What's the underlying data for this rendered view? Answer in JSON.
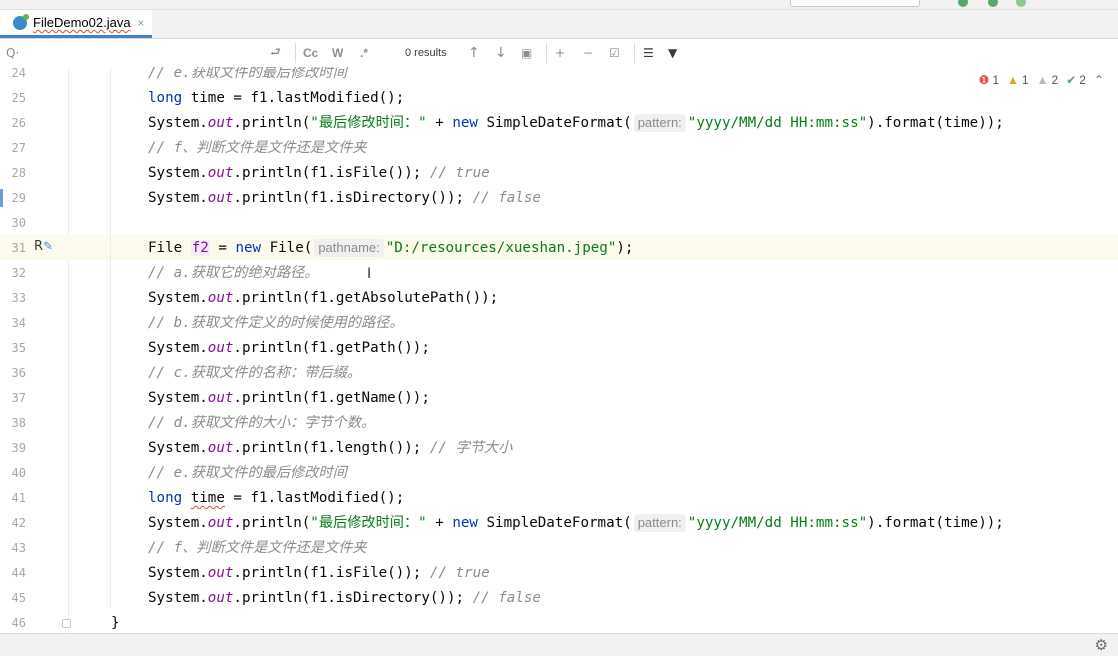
{
  "tab": {
    "filename": "FileDemo02.java",
    "close": "×"
  },
  "search": {
    "icon": "Q·",
    "match_case": "Cc",
    "words": "W",
    "regex": ".*",
    "results": "0 results"
  },
  "inspections": {
    "errors": "1",
    "warnings": "1",
    "weak_warnings": "2",
    "ok": "2"
  },
  "status": {
    "gear": "⚙"
  },
  "lines": [
    {
      "n": "24",
      "tokens": [
        {
          "t": "cmt",
          "v": "// e.获取文件的最后修改时间"
        }
      ]
    },
    {
      "n": "25",
      "tokens": [
        {
          "t": "kw",
          "v": "long"
        },
        {
          "t": "plain",
          "v": " time = f1.lastModified();"
        }
      ]
    },
    {
      "n": "26",
      "tokens": [
        {
          "t": "plain",
          "v": "System."
        },
        {
          "t": "field",
          "v": "out"
        },
        {
          "t": "plain",
          "v": ".println("
        },
        {
          "t": "str",
          "v": "\"最后修改时间：\""
        },
        {
          "t": "plain",
          "v": " + "
        },
        {
          "t": "kw",
          "v": "new"
        },
        {
          "t": "plain",
          "v": " SimpleDateFormat("
        },
        {
          "t": "hint",
          "v": "pattern:"
        },
        {
          "t": "str",
          "v": "\"yyyy/MM/dd HH:mm:ss\""
        },
        {
          "t": "plain",
          "v": ").format(time));"
        }
      ]
    },
    {
      "n": "27",
      "tokens": [
        {
          "t": "cmt",
          "v": "// f、判断文件是文件还是文件夹"
        }
      ]
    },
    {
      "n": "28",
      "tokens": [
        {
          "t": "plain",
          "v": "System."
        },
        {
          "t": "field",
          "v": "out"
        },
        {
          "t": "plain",
          "v": ".println(f1.isFile()); "
        },
        {
          "t": "cmt",
          "v": "// true"
        }
      ]
    },
    {
      "n": "29",
      "tokens": [
        {
          "t": "plain",
          "v": "System."
        },
        {
          "t": "field",
          "v": "out"
        },
        {
          "t": "plain",
          "v": ".println(f1.isDirectory()); "
        },
        {
          "t": "cmt",
          "v": "// false"
        }
      ]
    },
    {
      "n": "30",
      "tokens": []
    },
    {
      "n": "31",
      "tokens": [
        {
          "t": "plain",
          "v": "File "
        },
        {
          "t": "local",
          "v": "f2"
        },
        {
          "t": "plain",
          "v": " = "
        },
        {
          "t": "kw",
          "v": "new"
        },
        {
          "t": "plain",
          "v": " File("
        },
        {
          "t": "hint",
          "v": "pathname:"
        },
        {
          "t": "str",
          "v": "\"D:/resources/xueshan.jpeg\""
        },
        {
          "t": "plain",
          "v": ");"
        }
      ]
    },
    {
      "n": "32",
      "tokens": [
        {
          "t": "cmt",
          "v": "// a.获取它的绝对路径。"
        }
      ]
    },
    {
      "n": "33",
      "tokens": [
        {
          "t": "plain",
          "v": "System."
        },
        {
          "t": "field",
          "v": "out"
        },
        {
          "t": "plain",
          "v": ".println(f1.getAbsolutePath());"
        }
      ]
    },
    {
      "n": "34",
      "tokens": [
        {
          "t": "cmt",
          "v": "// b.获取文件定义的时候使用的路径。"
        }
      ]
    },
    {
      "n": "35",
      "tokens": [
        {
          "t": "plain",
          "v": "System."
        },
        {
          "t": "field",
          "v": "out"
        },
        {
          "t": "plain",
          "v": ".println(f1.getPath());"
        }
      ]
    },
    {
      "n": "36",
      "tokens": [
        {
          "t": "cmt",
          "v": "// c.获取文件的名称：带后缀。"
        }
      ]
    },
    {
      "n": "37",
      "tokens": [
        {
          "t": "plain",
          "v": "System."
        },
        {
          "t": "field",
          "v": "out"
        },
        {
          "t": "plain",
          "v": ".println(f1.getName());"
        }
      ]
    },
    {
      "n": "38",
      "tokens": [
        {
          "t": "cmt",
          "v": "// d.获取文件的大小：字节个数。"
        }
      ]
    },
    {
      "n": "39",
      "tokens": [
        {
          "t": "plain",
          "v": "System."
        },
        {
          "t": "field",
          "v": "out"
        },
        {
          "t": "plain",
          "v": ".println(f1.length()); "
        },
        {
          "t": "cmt",
          "v": "// 字节大小"
        }
      ]
    },
    {
      "n": "40",
      "tokens": [
        {
          "t": "cmt",
          "v": "// e.获取文件的最后修改时间"
        }
      ]
    },
    {
      "n": "41",
      "tokens": [
        {
          "t": "kw",
          "v": "long"
        },
        {
          "t": "plain",
          "v": " "
        },
        {
          "t": "squig",
          "v": "time"
        },
        {
          "t": "plain",
          "v": " = f1.lastModified();"
        }
      ]
    },
    {
      "n": "42",
      "tokens": [
        {
          "t": "plain",
          "v": "System."
        },
        {
          "t": "field",
          "v": "out"
        },
        {
          "t": "plain",
          "v": ".println("
        },
        {
          "t": "str",
          "v": "\"最后修改时间：\""
        },
        {
          "t": "plain",
          "v": " + "
        },
        {
          "t": "kw",
          "v": "new"
        },
        {
          "t": "plain",
          "v": " SimpleDateFormat("
        },
        {
          "t": "hint",
          "v": "pattern:"
        },
        {
          "t": "str",
          "v": "\"yyyy/MM/dd HH:mm:ss\""
        },
        {
          "t": "plain",
          "v": ").format(time));"
        }
      ]
    },
    {
      "n": "43",
      "tokens": [
        {
          "t": "cmt",
          "v": "// f、判断文件是文件还是文件夹"
        }
      ]
    },
    {
      "n": "44",
      "tokens": [
        {
          "t": "plain",
          "v": "System."
        },
        {
          "t": "field",
          "v": "out"
        },
        {
          "t": "plain",
          "v": ".println(f1.isFile()); "
        },
        {
          "t": "cmt",
          "v": "// true"
        }
      ]
    },
    {
      "n": "45",
      "tokens": [
        {
          "t": "plain",
          "v": "System."
        },
        {
          "t": "field",
          "v": "out"
        },
        {
          "t": "plain",
          "v": ".println(f1.isDirectory()); "
        },
        {
          "t": "cmt",
          "v": "// false"
        }
      ]
    },
    {
      "n": "46",
      "tokens": [
        {
          "t": "plain",
          "v": "}"
        }
      ]
    }
  ]
}
